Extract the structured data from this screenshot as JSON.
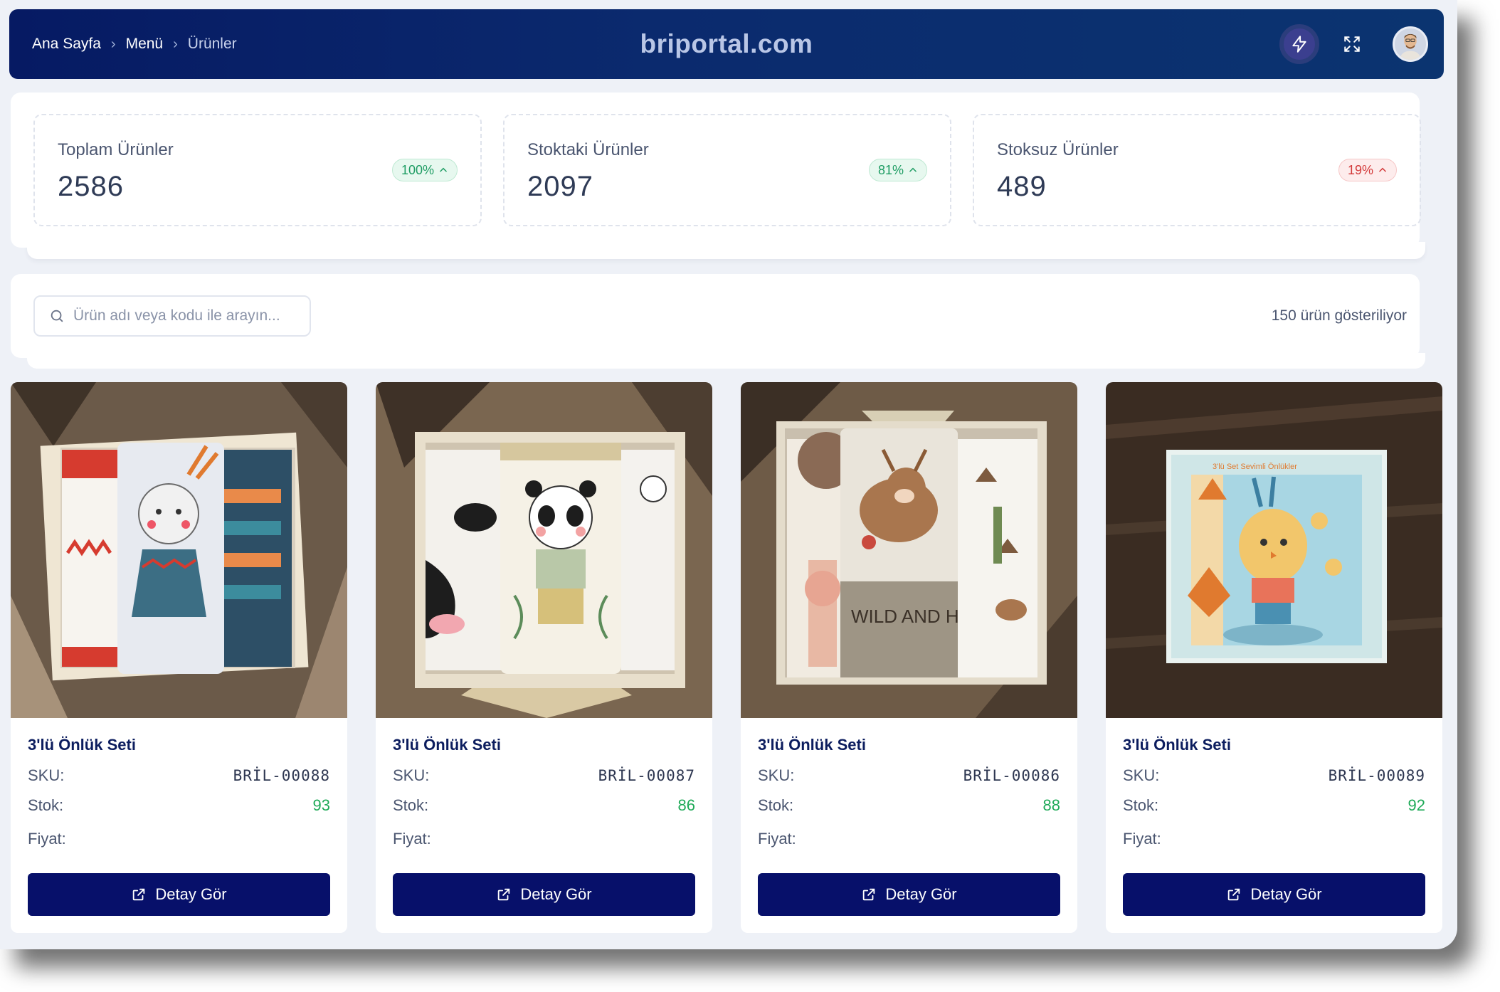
{
  "header": {
    "breadcrumb": [
      "Ana Sayfa",
      "Menü",
      "Ürünler"
    ],
    "brand": "briportal.com",
    "action_icon": "lightning-icon",
    "expand_icon": "expand-icon",
    "avatar_icon": "user-avatar"
  },
  "stats": [
    {
      "label": "Toplam Ürünler",
      "value": "2586",
      "badge": "100%",
      "trend": "up",
      "color": "#1f9d64"
    },
    {
      "label": "Stoktaki Ürünler",
      "value": "2097",
      "badge": "81%",
      "trend": "up",
      "color": "#1f9d64"
    },
    {
      "label": "Stoksuz Ürünler",
      "value": "489",
      "badge": "19%",
      "trend": "up",
      "color": "#d33a3a"
    }
  ],
  "search": {
    "placeholder": "Ürün adı veya kodu ile arayın...",
    "value": "",
    "result_count": "150 ürün gösteriliyor"
  },
  "product_labels": {
    "sku": "SKU:",
    "stock": "Stok:",
    "price": "Fiyat:",
    "detail_button": "Detay Gör"
  },
  "products": [
    {
      "title": "3'lü Önlük Seti",
      "sku": "BRİL-00088",
      "stock": "93",
      "price": "",
      "image": "bib-set-bear-photo"
    },
    {
      "title": "3'lü Önlük Seti",
      "sku": "BRİL-00087",
      "stock": "86",
      "price": "",
      "image": "bib-set-panda-photo"
    },
    {
      "title": "3'lü Önlük Seti",
      "sku": "BRİL-00086",
      "stock": "88",
      "price": "",
      "image": "bib-set-deer-photo"
    },
    {
      "title": "3'lü Önlük Seti",
      "sku": "BRİL-00089",
      "stock": "92",
      "price": "",
      "image": "bib-set-bird-photo"
    }
  ],
  "colors": {
    "header_gradient_start": "#061a63",
    "header_gradient_end": "#0b3470",
    "button": "#07106a",
    "stock_green": "#1faa58",
    "badge_green": "#1f9d64",
    "badge_red": "#d33a3a"
  }
}
